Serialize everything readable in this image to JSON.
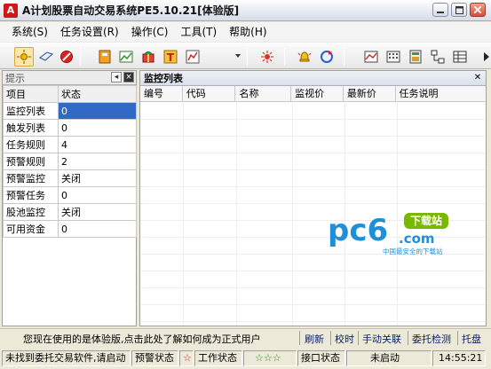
{
  "window": {
    "logo_letter": "A",
    "title": "A计划股票自动交易系统PE5.10.21[体验版]",
    "controls": [
      "minimize",
      "restore",
      "close"
    ]
  },
  "menu": [
    {
      "label": "系统(S)"
    },
    {
      "label": "任务设置(R)"
    },
    {
      "label": "操作(C)"
    },
    {
      "label": "工具(T)"
    },
    {
      "label": "帮助(H)"
    }
  ],
  "toolbar": {
    "icons": [
      "sun-icon",
      "tag-icon",
      "stop-icon",
      "book-icon",
      "chart-icon",
      "gift-icon",
      "letter-t-icon",
      "grid-chart-icon",
      "sun-burst-icon",
      "bell-icon",
      "refresh-icon",
      "line-chart-icon",
      "dots-panel-icon",
      "register-icon",
      "network-icon",
      "table-icon"
    ]
  },
  "left_panel": {
    "title": "提示",
    "header": [
      "项目",
      "状态"
    ],
    "rows": [
      {
        "name": "监控列表",
        "value": "0"
      },
      {
        "name": "触发列表",
        "value": "0"
      },
      {
        "name": "任务规则",
        "value": "4"
      },
      {
        "name": "预警规则",
        "value": "2"
      },
      {
        "name": "预警监控",
        "value": "关闭"
      },
      {
        "name": "预警任务",
        "value": "0"
      },
      {
        "name": "股池监控",
        "value": "关闭"
      },
      {
        "name": "可用资金",
        "value": "0"
      }
    ]
  },
  "right_panel": {
    "title": "监控列表",
    "columns": [
      "编号",
      "代码",
      "名称",
      "监视价",
      "最新价",
      "任务说明"
    ]
  },
  "watermark": {
    "brand": "pc6",
    "badge": "下载站",
    "domain": ".com",
    "slogan": "中国最安全的下载站"
  },
  "infobar": {
    "message": "您现在使用的是体验版,点击此处了解如何成为正式用户",
    "links": [
      "刷新",
      "校时",
      "手动关联",
      "委托检测",
      "托盘"
    ]
  },
  "statusbar": {
    "broker": "未找到委托交易软件,请启动",
    "alert_label": "预警状态",
    "alert_star": "☆",
    "work_label": "工作状态",
    "work_stars": "☆☆☆",
    "interface_label": "接口状态",
    "interface_value": "未启动",
    "clock": "14:55:21"
  },
  "colors": {
    "selection": "#316ac5",
    "link": "#0a246a",
    "brand_blue": "#1e8fd8",
    "brand_green": "#7ab800"
  }
}
